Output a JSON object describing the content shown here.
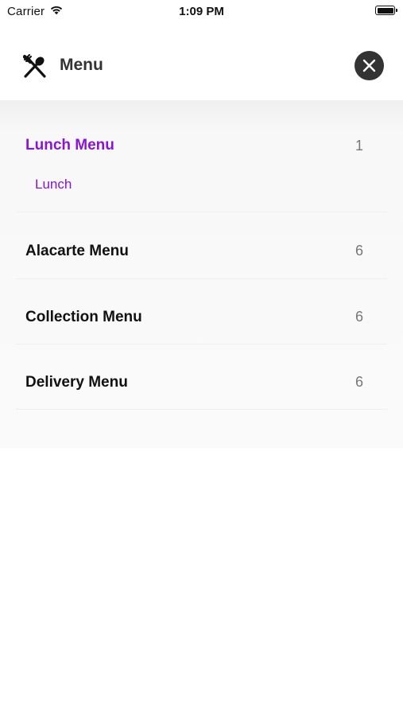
{
  "status_bar": {
    "carrier": "Carrier",
    "time": "1:09 PM"
  },
  "header": {
    "title": "Menu",
    "icon": "utensils-icon",
    "close_icon": "close-icon"
  },
  "menus": [
    {
      "name": "Lunch Menu",
      "count": "1",
      "active": true,
      "sub_items": [
        "Lunch"
      ]
    },
    {
      "name": "Alacarte Menu",
      "count": "6",
      "active": false
    },
    {
      "name": "Collection Menu",
      "count": "6",
      "active": false
    },
    {
      "name": "Delivery Menu",
      "count": "6",
      "active": false
    }
  ],
  "colors": {
    "accent": "#8a14d6",
    "close_button": "#333333",
    "panel_bg": "#fafafa"
  }
}
